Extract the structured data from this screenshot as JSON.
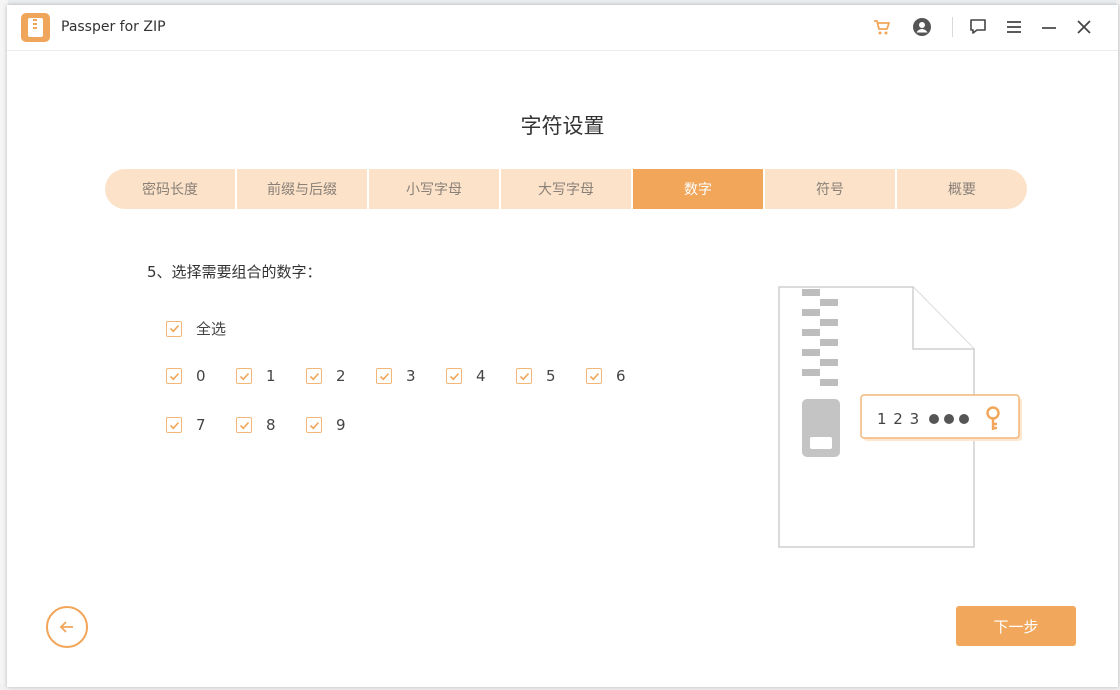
{
  "window": {
    "title": "Passper for ZIP"
  },
  "page": {
    "title": "字符设置"
  },
  "tabs": [
    {
      "label": "密码长度",
      "active": false
    },
    {
      "label": "前缀与后缀",
      "active": false
    },
    {
      "label": "小写字母",
      "active": false
    },
    {
      "label": "大写字母",
      "active": false
    },
    {
      "label": "数字",
      "active": true
    },
    {
      "label": "符号",
      "active": false
    },
    {
      "label": "概要",
      "active": false
    }
  ],
  "section": {
    "title": "5、选择需要组合的数字：",
    "select_all_label": "全选",
    "digits": [
      "0",
      "1",
      "2",
      "3",
      "4",
      "5",
      "6",
      "7",
      "8",
      "9"
    ]
  },
  "illustration": {
    "code_text": "1 2 3"
  },
  "footer": {
    "next_label": "下一步"
  },
  "colors": {
    "accent": "#f1a65a",
    "tab_background": "#fbe2c9",
    "checkbox_border": "#f1b678"
  },
  "icons": {
    "cart": "cart-icon",
    "account": "account-icon",
    "feedback": "feedback-icon",
    "menu": "menu-icon",
    "minimize": "minimize-icon",
    "close": "close-icon",
    "back": "arrow-left-icon",
    "key": "key-icon"
  }
}
